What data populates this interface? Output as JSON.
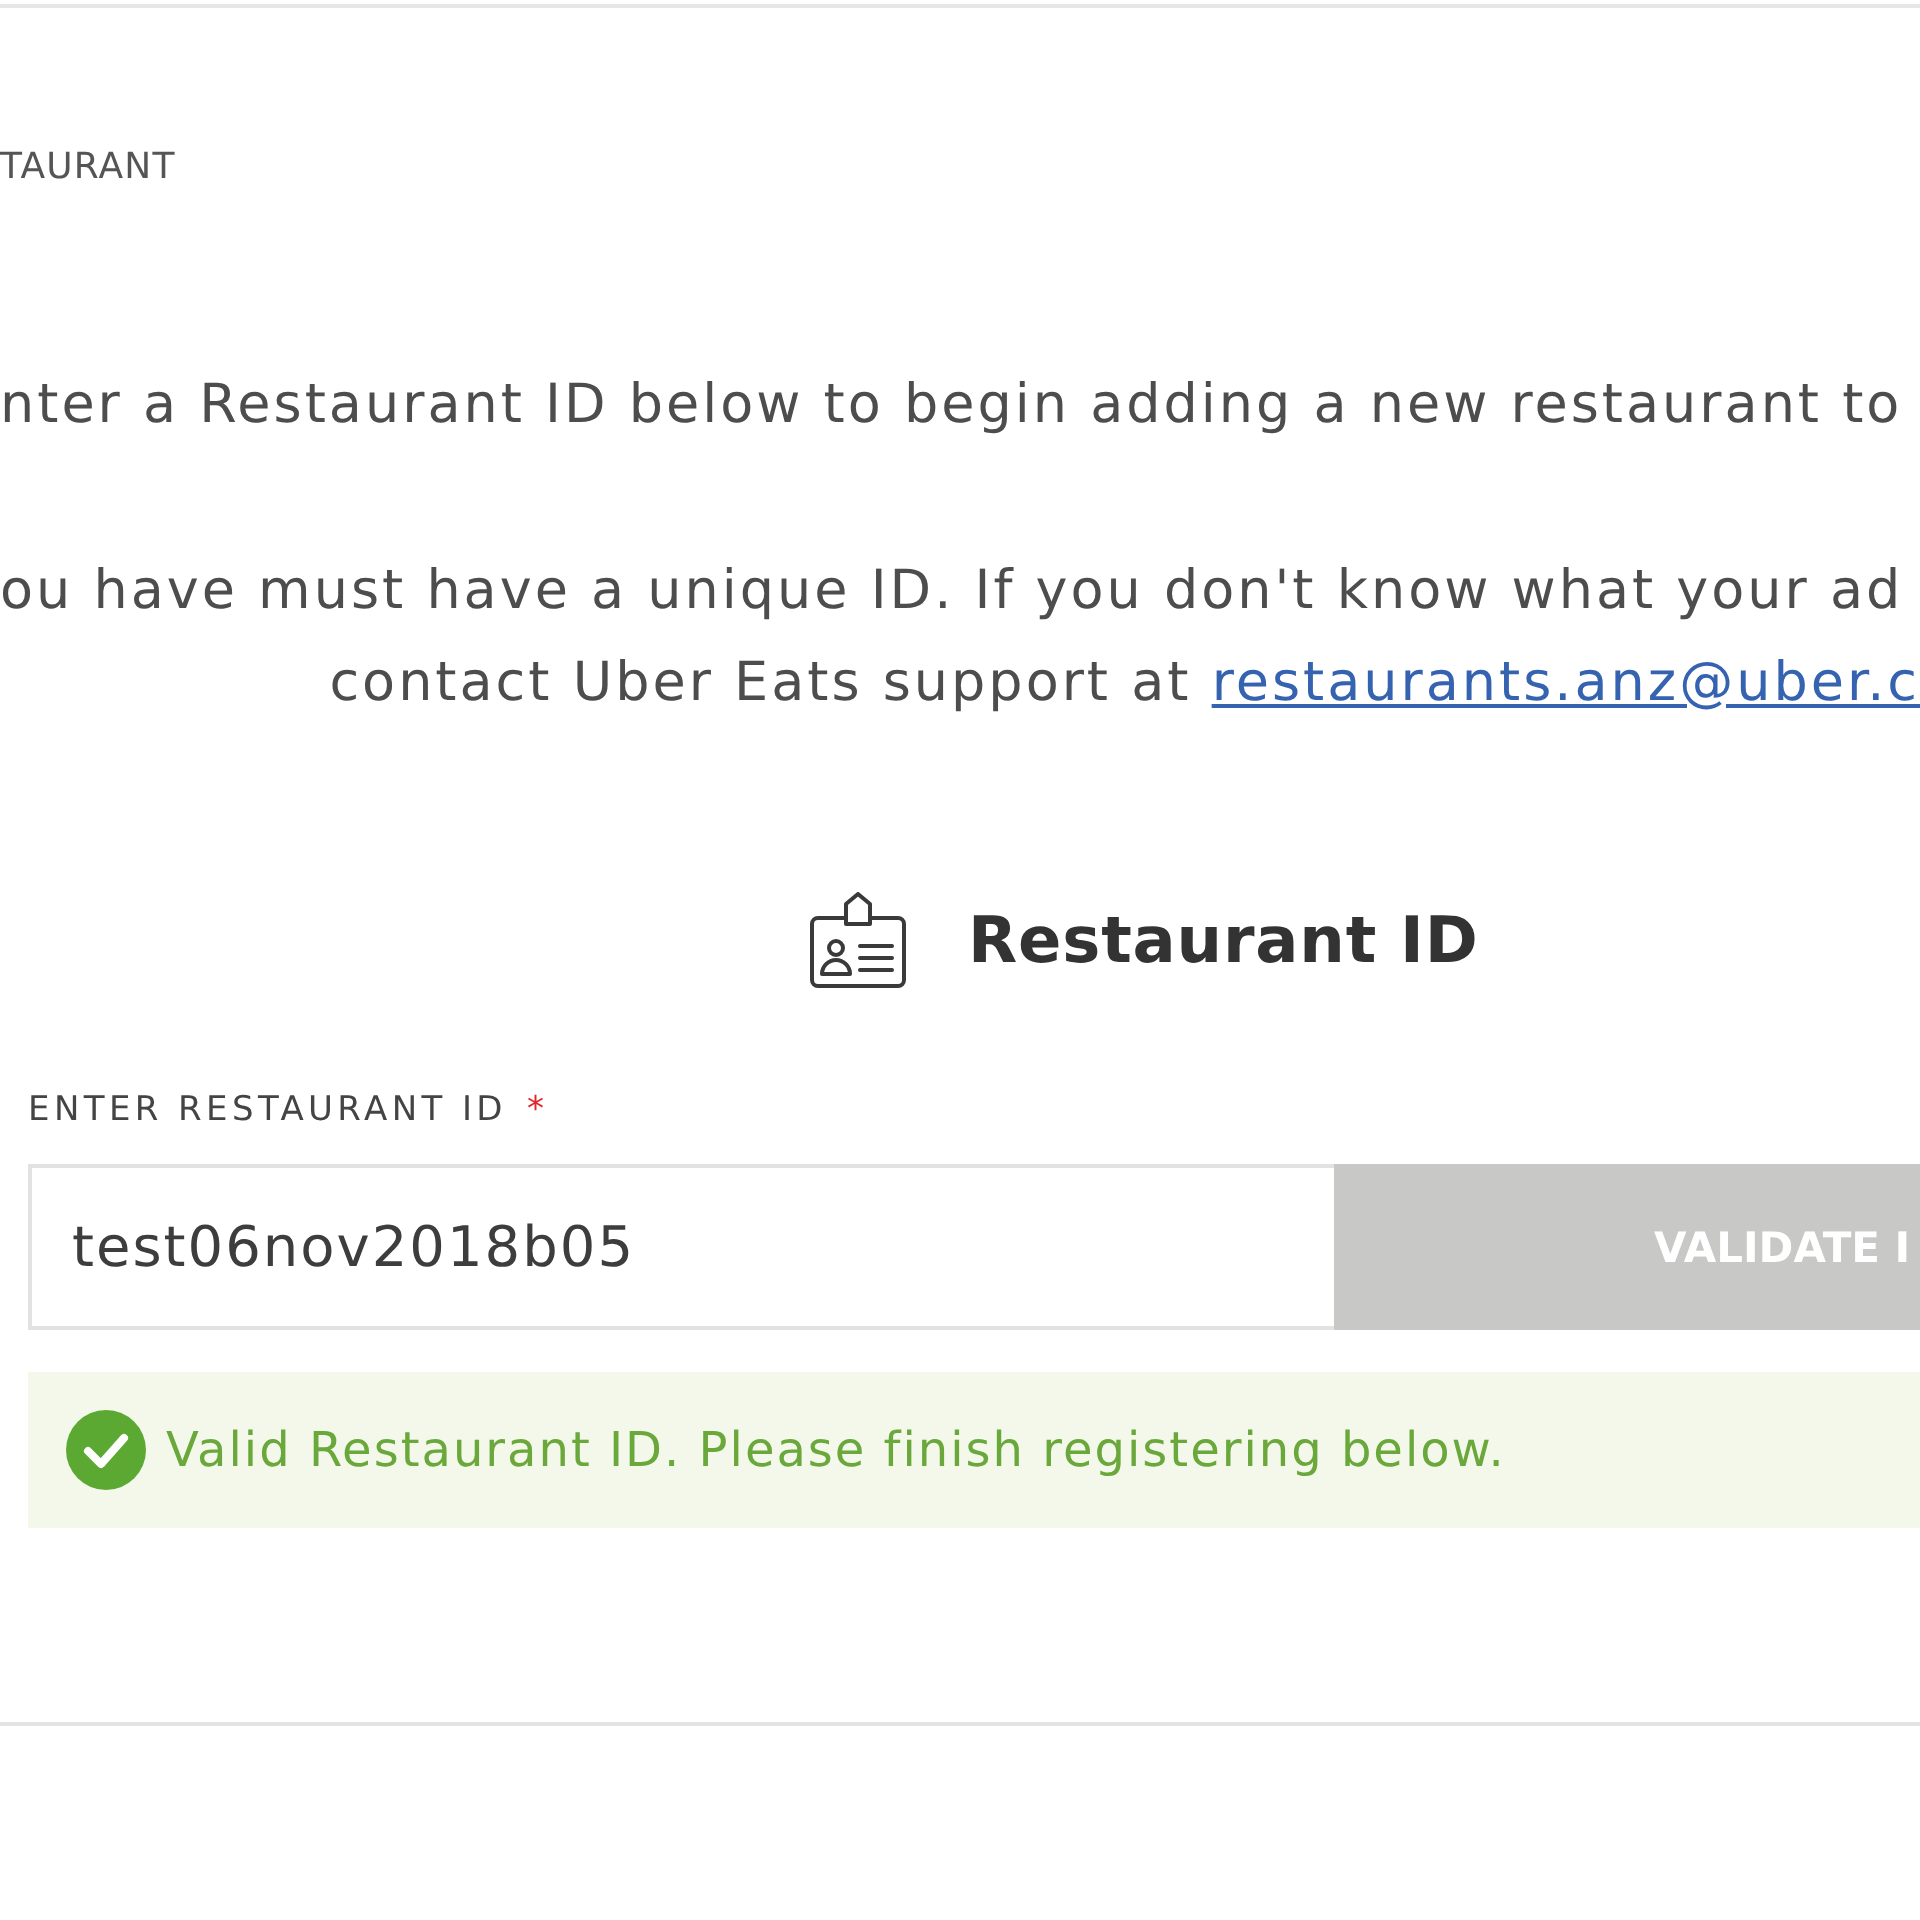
{
  "section_label": "TAURANT",
  "intro": {
    "line_1": "nter a Restaurant ID below to begin adding a new restaurant to",
    "line_2": "ou have must have a unique ID. If you don't know what your ad",
    "line_3": "contact Uber Eats support at",
    "link": "restaurants.anz@uber.c"
  },
  "heading": {
    "title": "Restaurant ID"
  },
  "field": {
    "label": "ENTER RESTAURANT ID",
    "required_mark": "*",
    "value": "test06nov2018b05"
  },
  "validate_button": {
    "label": "VALIDATE I",
    "disabled": true
  },
  "status": {
    "kind": "success",
    "message": "Valid Restaurant ID. Please finish registering below."
  }
}
